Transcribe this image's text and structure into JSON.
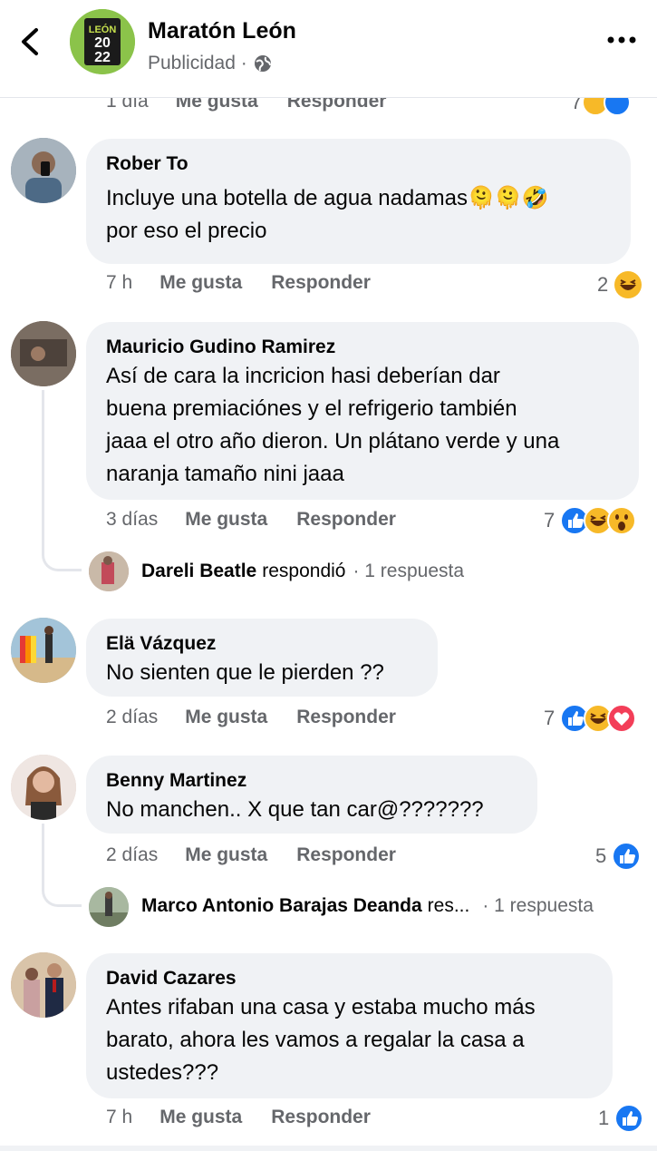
{
  "header": {
    "page_name": "Maratón León",
    "subtitle": "Publicidad ·",
    "logo_text": "LEÓN 2022"
  },
  "cut_row": {
    "time": "1 día",
    "like": "Me gusta",
    "reply": "Responder",
    "count": "7"
  },
  "comments": [
    {
      "author": "Rober To",
      "text": "Incluye una botella de agua nadamas🫠🫠🤣 por eso el precio",
      "line1": "Incluye una botella de agua nadamas",
      "line2": "por eso el precio",
      "time": "7 h",
      "like": "Me gusta",
      "reply": "Responder",
      "reaction_count": "2",
      "reactions": [
        "haha"
      ]
    },
    {
      "author": "Mauricio Gudino Ramirez",
      "lines": [
        "Así de cara la incricion hasi deberían dar",
        "buena premiaciónes y el refrigerio también",
        "jaaa el otro año dieron. Un plátano verde y una",
        "naranja tamaño nini jaaa"
      ],
      "time": "3 días",
      "like": "Me gusta",
      "reply": "Responder",
      "reaction_count": "7",
      "reactions": [
        "like",
        "haha",
        "wow"
      ],
      "reply_preview": {
        "name": "Dareli Beatle",
        "verb": "respondió",
        "count": "· 1 respuesta"
      }
    },
    {
      "author": "Elä Vázquez",
      "text": "No sienten que le pierden ??",
      "time": "2 días",
      "like": "Me gusta",
      "reply": "Responder",
      "reaction_count": "7",
      "reactions": [
        "like",
        "haha",
        "love"
      ]
    },
    {
      "author": "Benny Martinez",
      "text": "No manchen.. X que tan car@???????",
      "time": "2 días",
      "like": "Me gusta",
      "reply": "Responder",
      "reaction_count": "5",
      "reactions": [
        "like"
      ],
      "reply_preview": {
        "name": "Marco Antonio Barajas Deanda",
        "verb": "res...",
        "count": "· 1 respuesta"
      }
    },
    {
      "author": "David Cazares",
      "lines": [
        "Antes rifaban una casa y estaba mucho más",
        "barato, ahora les vamos a regalar la casa a",
        "ustedes???"
      ],
      "time": "7 h",
      "like": "Me gusta",
      "reply": "Responder",
      "reaction_count": "1",
      "reactions": [
        "like"
      ]
    }
  ],
  "colors": {
    "bubble": "#f0f2f5",
    "secondary_text": "#65676b",
    "like_blue": "#1877f2",
    "love_red": "#f33e58",
    "haha_yellow": "#f7b928"
  }
}
